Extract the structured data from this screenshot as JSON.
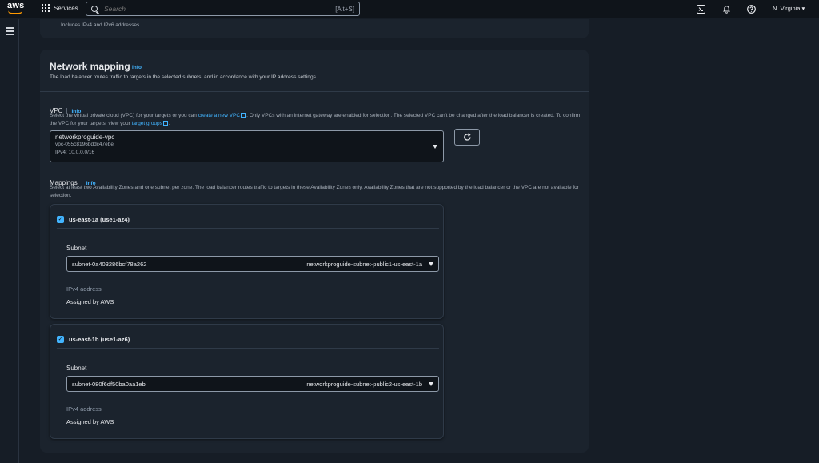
{
  "topnav": {
    "logo": "aws",
    "services_label": "Services",
    "search_placeholder": "Search",
    "search_shortcut": "[Alt+S]",
    "region": "N. Virginia ▾",
    "icons": [
      "cloudshell-icon",
      "bell-icon",
      "help-icon"
    ]
  },
  "prev_section": {
    "text": "Includes IPv4 and IPv6 addresses."
  },
  "network_mapping": {
    "title": "Network mapping",
    "info": "Info",
    "description": "The load balancer routes traffic to targets in the selected subnets, and in accordance with your IP address settings.",
    "vpc": {
      "label": "VPC",
      "info": "Info",
      "desc_part1": "Select the virtual private cloud (VPC) for your targets or you can ",
      "link_create": "create a new VPC",
      "desc_part2": ". Only VPCs with an internet gateway are enabled for selection. The selected VPC can't be changed after the load balancer is created. To confirm the VPC for your targets, view your ",
      "link_target_groups": "target groups",
      "desc_part3": ".",
      "selected_name": "networkproguide-vpc",
      "selected_id": "vpc-055c8196bddc47ebe",
      "selected_cidr": "IPv4: 10.0.0.0/16"
    },
    "mappings": {
      "label": "Mappings",
      "info": "Info",
      "description": "Select at least two Availability Zones and one subnet per zone. The load balancer routes traffic to targets in these Availability Zones only. Availability Zones that are not supported by the load balancer or the VPC are not available for selection.",
      "zones": [
        {
          "name": "us-east-1a (use1-az4)",
          "checked": true,
          "subnet_label": "Subnet",
          "subnet_id": "subnet-0a403286bcf78a262",
          "subnet_name": "networkproguide-subnet-public1-us-east-1a",
          "ipv4_label": "IPv4 address",
          "ipv4_value": "Assigned by AWS"
        },
        {
          "name": "us-east-1b (use1-az6)",
          "checked": true,
          "subnet_label": "Subnet",
          "subnet_id": "subnet-080f6df50ba0aa1eb",
          "subnet_name": "networkproguide-subnet-public2-us-east-1b",
          "ipv4_label": "IPv4 address",
          "ipv4_value": "Assigned by AWS"
        }
      ]
    }
  },
  "colors": {
    "accent": "#42b4ff",
    "background": "#161d26",
    "card": "#1b232d",
    "brand": "#ff9900"
  }
}
